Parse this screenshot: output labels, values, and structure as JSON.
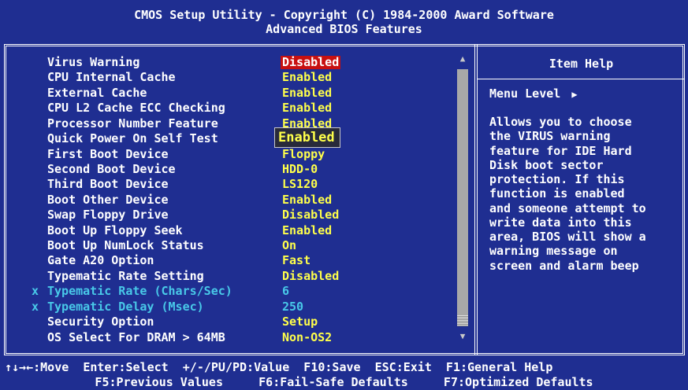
{
  "header": {
    "line1": "CMOS Setup Utility - Copyright (C) 1984-2000 Award Software",
    "line2": "Advanced BIOS Features"
  },
  "settings": [
    {
      "label": "Virus Warning",
      "value": "Disabled",
      "marker": ""
    },
    {
      "label": "CPU Internal Cache",
      "value": "Enabled",
      "marker": ""
    },
    {
      "label": "External Cache",
      "value": "Enabled",
      "marker": ""
    },
    {
      "label": "CPU L2 Cache ECC Checking",
      "value": "Enabled",
      "marker": ""
    },
    {
      "label": "Processor Number Feature",
      "value": "Enabled",
      "marker": ""
    },
    {
      "label": "Quick Power On Self Test",
      "value": "Enabled",
      "marker": ""
    },
    {
      "label": "First Boot Device",
      "value": "Floppy",
      "marker": ""
    },
    {
      "label": "Second Boot Device",
      "value": "HDD-0",
      "marker": ""
    },
    {
      "label": "Third Boot Device",
      "value": "LS120",
      "marker": ""
    },
    {
      "label": "Boot Other Device",
      "value": "Enabled",
      "marker": ""
    },
    {
      "label": "Swap Floppy Drive",
      "value": "Disabled",
      "marker": ""
    },
    {
      "label": "Boot Up Floppy Seek",
      "value": "Enabled",
      "marker": ""
    },
    {
      "label": "Boot Up NumLock Status",
      "value": "On",
      "marker": ""
    },
    {
      "label": "Gate A20 Option",
      "value": "Fast",
      "marker": ""
    },
    {
      "label": "Typematic Rate Setting",
      "value": "Disabled",
      "marker": ""
    },
    {
      "label": "Typematic Rate (Chars/Sec)",
      "value": "6",
      "marker": "x"
    },
    {
      "label": "Typematic Delay (Msec)",
      "value": "250",
      "marker": "x"
    },
    {
      "label": "Security Option",
      "value": "Setup",
      "marker": ""
    },
    {
      "label": "OS Select For DRAM > 64MB",
      "value": "Non-OS2",
      "marker": ""
    }
  ],
  "help": {
    "title": "Item Help",
    "menu_level": "Menu Level",
    "lines": [
      "Allows you to choose",
      "the VIRUS warning",
      "feature for IDE Hard",
      "Disk boot sector",
      "protection. If this",
      "function is enabled",
      "and someone attempt to",
      "write data into this",
      "area, BIOS will show a",
      "warning message on",
      "screen and alarm beep"
    ]
  },
  "footer": {
    "line1": "↑↓→←:Move  Enter:Select  +/-/PU/PD:Value  F10:Save  ESC:Exit  F1:General Help",
    "line2": "F5:Previous Values     F6:Fail-Safe Defaults     F7:Optimized Defaults"
  },
  "colors": {
    "background": "#1f2e91",
    "value_yellow": "#ffff4a",
    "disabled_cyan": "#48c8e8",
    "highlight_red": "#c81010"
  }
}
